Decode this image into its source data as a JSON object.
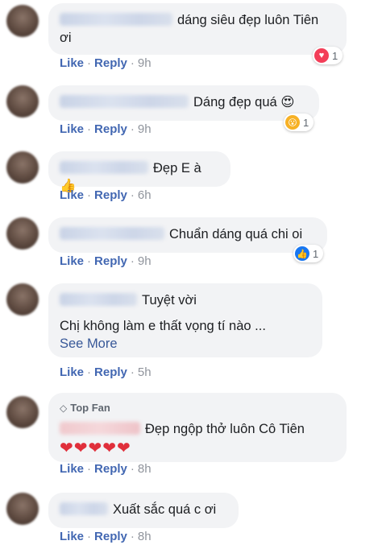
{
  "action_labels": {
    "like": "Like",
    "reply": "Reply",
    "separator": "·"
  },
  "comments": [
    {
      "text_line1": "dáng siêu đẹp luôn Tiên",
      "text_line2": "ơi",
      "time": "9h",
      "reaction_icon": "love-icon",
      "reaction_count": "1"
    },
    {
      "text": "Dáng đẹp quá",
      "emoji": "😍",
      "time": "9h",
      "reaction_icon": "wow-icon",
      "reaction_count": "1"
    },
    {
      "text": "Đẹp E à",
      "emoji": "👍",
      "time": "6h"
    },
    {
      "text": "Chuẩn dáng quá chi oi",
      "time": "9h",
      "reaction_icon": "like-icon",
      "reaction_count": "1"
    },
    {
      "text_line1": "Tuyệt vời",
      "text_line2": "Chị không làm e thất vọng tí nào ...",
      "see_more": "See More",
      "time": "5h"
    },
    {
      "badge": "Top Fan",
      "text": "Đẹp ngộp thở luôn Cô Tiên",
      "hearts": "❤❤❤❤❤",
      "time": "8h"
    },
    {
      "text": "Xuất sắc quá c ơi",
      "time": "8h"
    }
  ]
}
